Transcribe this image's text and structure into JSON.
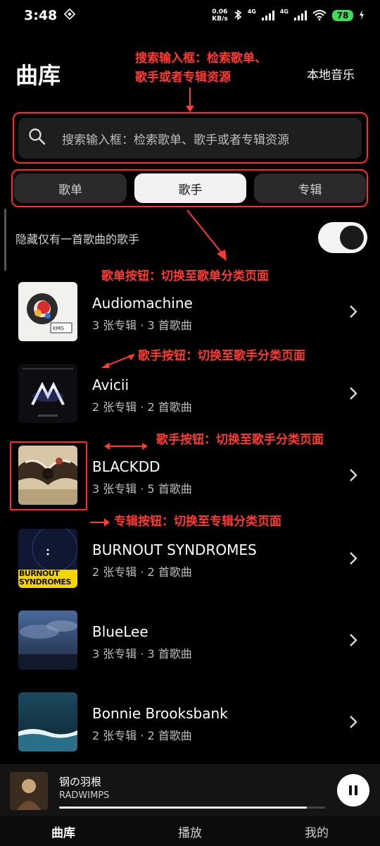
{
  "status_bar": {
    "time": "3:48",
    "net_speed_value": "0.06",
    "net_speed_unit": "KB/s",
    "network_1": "4G",
    "network_2": "4G",
    "battery": "78"
  },
  "header": {
    "title": "曲库",
    "local_music": "本地音乐"
  },
  "search": {
    "placeholder": "搜索输入框：检索歌单、歌手或者专辑资源"
  },
  "tabs": [
    {
      "label": "歌单",
      "active": false
    },
    {
      "label": "歌手",
      "active": true
    },
    {
      "label": "专辑",
      "active": false
    }
  ],
  "filter": {
    "label": "隐藏仅有一首歌曲的歌手",
    "enabled": true
  },
  "annotations": {
    "search_line1": "搜索输入框：检索歌单、",
    "search_line2": "歌手或者专辑资源",
    "playlist_btn": "歌单按钮：切换至歌单分类页面",
    "artist_btn_1": "歌手按钮：切换至歌手分类页面",
    "artist_btn_2": "歌手按钮：切换至歌手分类页面",
    "album_btn": "专辑按钮：切换至专辑分类页面"
  },
  "artists": [
    {
      "name": "Audiomachine",
      "meta": "3 张专辑 · 3 首歌曲"
    },
    {
      "name": "Avicii",
      "meta": "2 张专辑 · 2 首歌曲"
    },
    {
      "name": "BLACKDD",
      "meta": "3 张专辑 · 5 首歌曲"
    },
    {
      "name": "BURNOUT SYNDROMES",
      "meta": "2 张专辑 · 2 首歌曲"
    },
    {
      "name": "BlueLee",
      "meta": "3 张专辑 · 3 首歌曲"
    },
    {
      "name": "Bonnie Brooksbank",
      "meta": "2 张专辑 · 2 首歌曲"
    }
  ],
  "cover_text": {
    "burnout_line1": "BURNOUT",
    "burnout_line2": "SYNDROMES"
  },
  "now_playing": {
    "title": "钢の羽根",
    "artist": "RADWIMPS",
    "progress": 0.93
  },
  "bottom_nav": [
    {
      "label": "曲库",
      "active": true
    },
    {
      "label": "播放",
      "active": false
    },
    {
      "label": "我的",
      "active": false
    }
  ],
  "colors": {
    "annotation": "#ff3b2f",
    "battery": "#3ddc5a",
    "background": "#000000"
  }
}
